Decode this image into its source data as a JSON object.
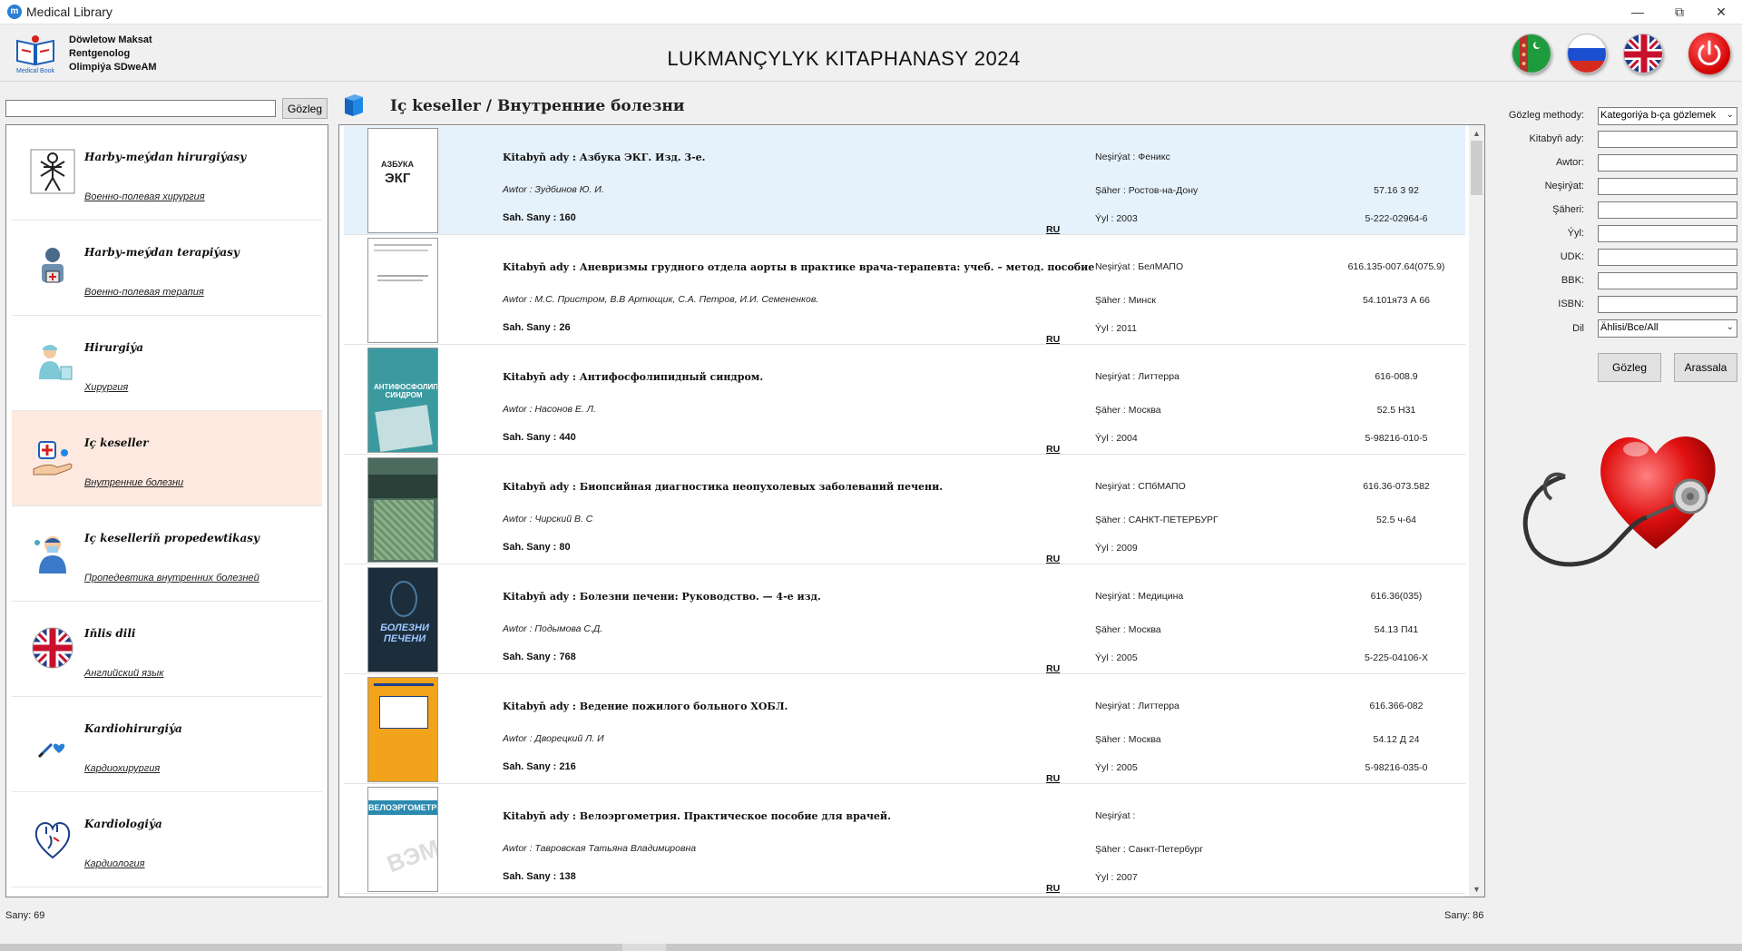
{
  "window": {
    "title": "Medical Library"
  },
  "header": {
    "user_name": "Döwletow Maksat",
    "user_role": "Rentgenolog",
    "user_org": "Olimpiýa SDweAM",
    "app_title": "LUKMANÇYLYK KITAPHANASY 2024",
    "logo_text": "Medical Book"
  },
  "left": {
    "search_value": "",
    "search_button": "Gözleg",
    "categories": [
      {
        "title": "Harby-meýdan hirurgiýasy",
        "subtitle": "Военно-полевая хирургия",
        "icon": "soldier-surgery-icon"
      },
      {
        "title": "Harby-meýdan terapiýasy",
        "subtitle": "Военно-полевая терапия",
        "icon": "soldier-therapy-icon"
      },
      {
        "title": "Hirurgiýa",
        "subtitle": "Хирургия",
        "icon": "surgeon-icon"
      },
      {
        "title": "Iç keseller",
        "subtitle": "Внутренние болезни",
        "icon": "internal-medicine-icon"
      },
      {
        "title": "Iç keselleriň propedewtikasy",
        "subtitle": "Пропедевтика внутренних болезней",
        "icon": "doctor-icon"
      },
      {
        "title": "Iňlis dili",
        "subtitle": "Английский язык",
        "icon": "uk-flag-icon"
      },
      {
        "title": "Kardiohirurgiýa",
        "subtitle": "Кардиохирургия",
        "icon": "heart-surgery-icon"
      },
      {
        "title": "Kardiologiýa",
        "subtitle": "Кардиология",
        "icon": "heart-icon"
      }
    ],
    "selected_index": 3
  },
  "main": {
    "heading": "Iç keseller / Внутренние болезни",
    "books": [
      {
        "title": "Kitabyň ady : Азбука ЭКГ. Изд. 3-е.",
        "author": "Awtor : Зудбинов Ю. И.",
        "pages": "Sah. Sany : 160",
        "lang": "RU",
        "publisher": "Neşirýat : Феникс",
        "city": "Şäher : Ростов-на-Дону",
        "year": "Ýyl : 2003",
        "udk": "",
        "bbk": "57.16 3 92",
        "isbn": "5-222-02964-6",
        "cover_text": "АЗБУКА ЭКГ",
        "cover_color": "#ffffff",
        "cover_ink": "#222222"
      },
      {
        "title": "Kitabyň ady : Аневризмы грудного отдела аорты в практике врача-терапевта: учеб. – метод. пособие",
        "author": "Awtor : М.С. Пристром, В.В Артющик, С.А. Петров, И.И. Семененков.",
        "pages": "Sah. Sany : 26",
        "lang": "RU",
        "publisher": "Neşirýat : БелМАПО",
        "city": "Şäher : Минск",
        "year": "Ýyl : 2011",
        "udk": "616.135-007.64(075.9)",
        "bbk": "54.101я73 А 66",
        "isbn": "",
        "cover_text": "",
        "cover_color": "#ffffff",
        "cover_ink": "#555555"
      },
      {
        "title": "Kitabyň ady : Антифосфолипидный синдром.",
        "author": "Awtor : Насонов Е. Л.",
        "pages": "Sah. Sany : 440",
        "lang": "RU",
        "publisher": "Neşirýat : Литтерра",
        "city": "Şäher : Москва",
        "year": "Ýyl : 2004",
        "udk": "616-008.9",
        "bbk": "52.5 Н31",
        "isbn": "5-98216-010-5",
        "cover_text": "АНТИФОСФОЛИПИДНЫЙ СИНДРОМ",
        "cover_color": "#3a9aa0",
        "cover_ink": "#ffffff"
      },
      {
        "title": "Kitabyň ady : Биопсийная диагностика неопухолевых заболеваний печени.",
        "author": "Awtor : Чирский В. С",
        "pages": "Sah. Sany : 80",
        "lang": "RU",
        "publisher": "Neşirýat : СПбМАПО",
        "city": "Şäher : САНКТ-ПЕТЕРБУРГ",
        "year": "Ýyl : 2009",
        "udk": "616.36-073.582",
        "bbk": "52.5 ч-64",
        "isbn": "",
        "cover_text": "",
        "cover_color": "#4c6a5e",
        "cover_ink": "#ffffff"
      },
      {
        "title": "Kitabyň ady : Болезни печени: Руководство. — 4-е изд.",
        "author": "Awtor : Подымова С.Д.",
        "pages": "Sah. Sany : 768",
        "lang": "RU",
        "publisher": "Neşirýat : Медицина",
        "city": "Şäher : Москва",
        "year": "Ýyl : 2005",
        "udk": "616.36(035)",
        "bbk": "54.13 П41",
        "isbn": "5-225-04106-X",
        "cover_text": "БОЛЕЗНИ ПЕЧЕНИ",
        "cover_color": "#1c2e3c",
        "cover_ink": "#cfe4ff"
      },
      {
        "title": "Kitabyň ady : Ведение пожилого больного ХОБЛ.",
        "author": "Awtor : Дворецкий Л. И",
        "pages": "Sah. Sany : 216",
        "lang": "RU",
        "publisher": "Neşirýat : Литтерра",
        "city": "Şäher : Москва",
        "year": "Ýyl : 2005",
        "udk": "616.366-082",
        "bbk": "54.12 Д 24",
        "isbn": "5-98216-035-0",
        "cover_text": "",
        "cover_color": "#f2a31b",
        "cover_ink": "#1c3f8a"
      },
      {
        "title": "Kitabyň ady : Велоэргометрия. Практическое пособие для врачей.",
        "author": "Awtor : Тавровская Татьяна Владимировна",
        "pages": "Sah. Sany : 138",
        "lang": "RU",
        "publisher": "Neşirýat :",
        "city": "Şäher : Санкт-Петербург",
        "year": "Ýyl : 2007",
        "udk": "",
        "bbk": "",
        "isbn": "",
        "cover_text": "ВЕЛОЭРГОМЕТРИЯ",
        "cover_color": "#ffffff",
        "cover_ink": "#ffffff"
      }
    ]
  },
  "search_form": {
    "method_label": "Gözleg methody:",
    "method_value": "Kategoriýa b-ça gözlemek",
    "title_label": "Kitabyň ady:",
    "author_label": "Awtor:",
    "publisher_label": "Neşirýat:",
    "city_label": "Şäheri:",
    "year_label": "Ýyl:",
    "udk_label": "UDK:",
    "bbk_label": "BBK:",
    "isbn_label": "ISBN:",
    "lang_label": "Dil",
    "lang_value": "Ählisi/Все/All",
    "search_button": "Gözleg",
    "clear_button": "Arassala"
  },
  "status": {
    "left_count": "Sany: 69",
    "right_count": "Sany: 86"
  },
  "colors": {
    "selected_category": "#fde9df",
    "selected_book": "#e5f1fb",
    "accent": "#2a7fd4"
  }
}
